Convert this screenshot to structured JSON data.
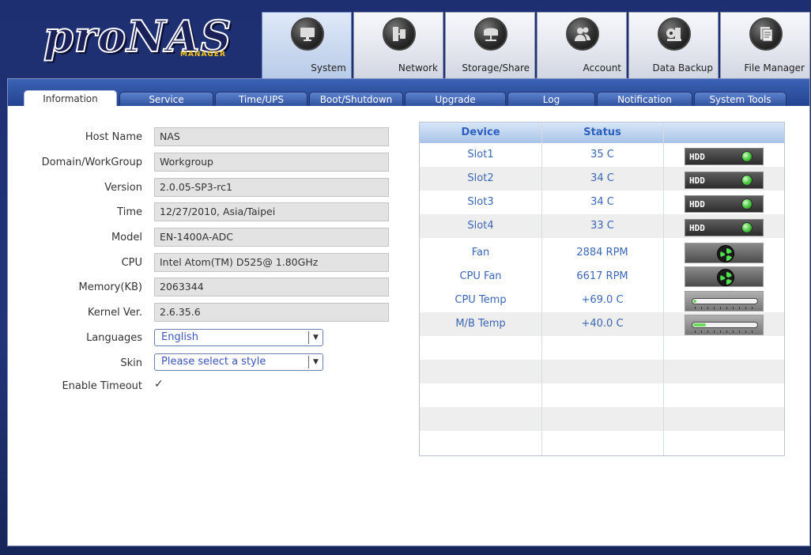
{
  "brand": {
    "name": "proNAS",
    "sub": "MANAGER"
  },
  "colors": {
    "accent": "#3c62b5",
    "status_text": "#3b66b3",
    "led_green": "#58d34b"
  },
  "topnav": [
    {
      "label": "System",
      "icon": "monitor-icon",
      "active": true
    },
    {
      "label": "Network",
      "icon": "network-icon",
      "active": false
    },
    {
      "label": "Storage/Share",
      "icon": "storage-icon",
      "active": false
    },
    {
      "label": "Account",
      "icon": "users-icon",
      "active": false
    },
    {
      "label": "Data Backup",
      "icon": "backup-icon",
      "active": false
    },
    {
      "label": "File Manager",
      "icon": "document-icon",
      "active": false
    }
  ],
  "subtabs": [
    {
      "label": "Information",
      "active": true
    },
    {
      "label": "Service",
      "active": false
    },
    {
      "label": "Time/UPS",
      "active": false
    },
    {
      "label": "Boot/Shutdown",
      "active": false
    },
    {
      "label": "Upgrade",
      "active": false
    },
    {
      "label": "Log",
      "active": false
    },
    {
      "label": "Notification",
      "active": false
    },
    {
      "label": "System Tools",
      "active": false
    }
  ],
  "info": [
    {
      "label": "Host Name",
      "value": "NAS"
    },
    {
      "label": "Domain/WorkGroup",
      "value": "Workgroup"
    },
    {
      "label": "Version",
      "value": "2.0.05-SP3-rc1"
    },
    {
      "label": "Time",
      "value": "12/27/2010, Asia/Taipei"
    },
    {
      "label": "Model",
      "value": "EN-1400A-ADC"
    },
    {
      "label": "CPU",
      "value": "Intel Atom(TM)  D525@ 1.80GHz"
    },
    {
      "label": "Memory(KB)",
      "value": "2063344"
    },
    {
      "label": "Kernel Ver.",
      "value": "2.6.35.6"
    }
  ],
  "languages": {
    "label": "Languages",
    "value": "English"
  },
  "skin": {
    "label": "Skin",
    "value": "Please select a style"
  },
  "timeout": {
    "label": "Enable Timeout",
    "checked": true,
    "mark": "✓"
  },
  "status": {
    "headers": {
      "device": "Device",
      "status": "Status"
    },
    "rows": [
      {
        "device": "Slot1",
        "status": "35 C",
        "indicator": "hdd",
        "indicator_text": "HDD"
      },
      {
        "device": "Slot2",
        "status": "34 C",
        "indicator": "hdd",
        "indicator_text": "HDD"
      },
      {
        "device": "Slot3",
        "status": "34 C",
        "indicator": "hdd",
        "indicator_text": "HDD"
      },
      {
        "device": "Slot4",
        "status": "33 C",
        "indicator": "hdd",
        "indicator_text": "HDD"
      },
      {
        "device": "Fan",
        "status": "2884 RPM",
        "indicator": "fan"
      },
      {
        "device": "CPU Fan",
        "status": "6617 RPM",
        "indicator": "fan"
      },
      {
        "device": "CPU Temp",
        "status": "+69.0 C",
        "indicator": "temp",
        "level": 0.05
      },
      {
        "device": "M/B Temp",
        "status": "+40.0 C",
        "indicator": "temp",
        "level": 0.2
      }
    ]
  }
}
